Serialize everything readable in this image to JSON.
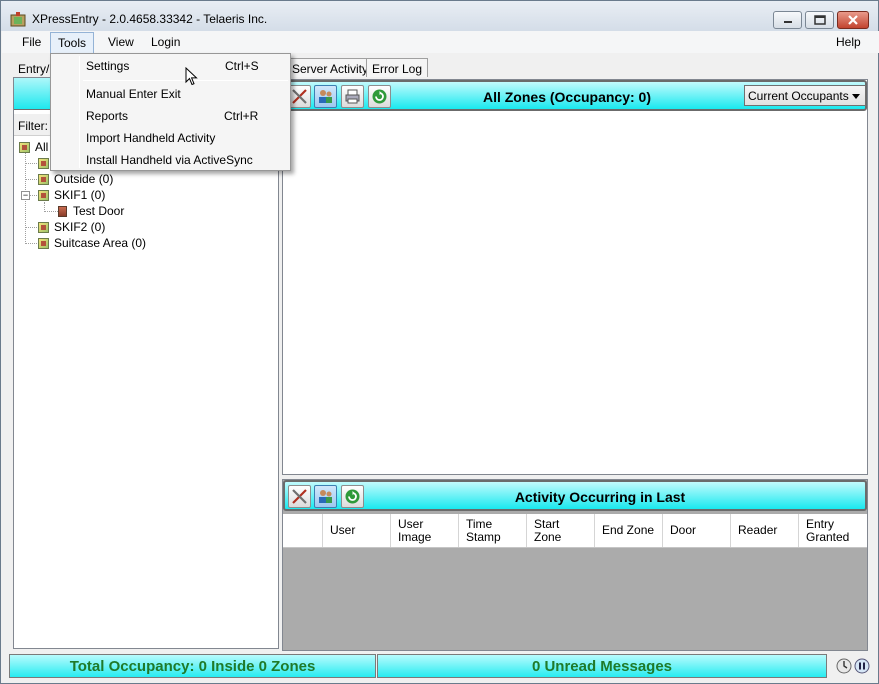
{
  "window": {
    "title": "XPressEntry - 2.0.4658.33342 - Telaeris Inc."
  },
  "menubar": {
    "items": [
      "File",
      "Tools",
      "View",
      "Login"
    ],
    "help": "Help"
  },
  "tools_menu": {
    "items": [
      {
        "label": "Settings",
        "shortcut": "Ctrl+S"
      },
      {
        "label": "Manual Enter Exit",
        "shortcut": ""
      },
      {
        "label": "Reports",
        "shortcut": "Ctrl+R"
      },
      {
        "label": "Import Handheld Activity",
        "shortcut": ""
      },
      {
        "label": "Install Handheld via ActiveSync",
        "shortcut": ""
      }
    ]
  },
  "tabs": [
    "Entry/E",
    "Server Activity",
    "Error Log"
  ],
  "left_panel": {
    "filter_label": "Filter:",
    "tree": [
      {
        "label": "All"
      },
      {
        "label": ""
      },
      {
        "label": "Outside (0)"
      },
      {
        "label": "SKIF1 (0)"
      },
      {
        "label": "Test Door"
      },
      {
        "label": "SKIF2 (0)"
      },
      {
        "label": "Suitcase Area (0)"
      }
    ]
  },
  "zones_panel": {
    "title": "All Zones (Occupancy: 0)",
    "view_select": "Current Occupants"
  },
  "activity_panel": {
    "title": "Activity Occurring in Last",
    "columns": [
      "User",
      "User Image",
      "Time Stamp",
      "Start Zone",
      "End Zone",
      "Door",
      "Reader",
      "Entry Granted"
    ]
  },
  "statusbar": {
    "occupancy": "Total Occupancy: 0 Inside 0 Zones",
    "messages": "0 Unread Messages"
  },
  "colors": {
    "header_cyan": "#19e9ef",
    "status_green_text": "#1f7a2a"
  }
}
